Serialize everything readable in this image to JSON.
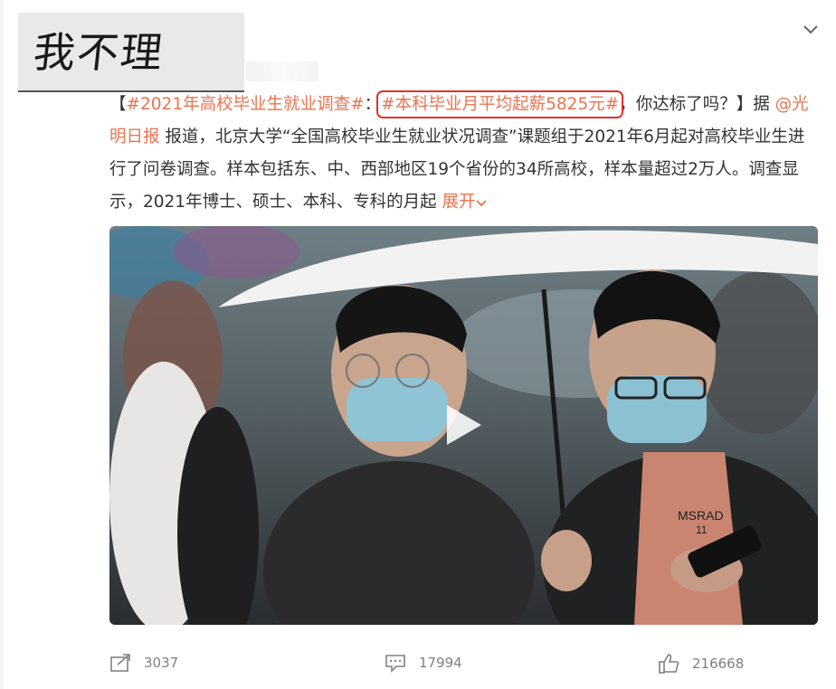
{
  "handwriting": "我不理解。",
  "post": {
    "segments": [
      {
        "kind": "text",
        "text": "【"
      },
      {
        "kind": "topic",
        "text": "#2021年高校毕业生就业调查#"
      },
      {
        "kind": "text",
        "text": "："
      },
      {
        "kind": "topic_boxed",
        "text": "#本科毕业月平均起薪5825元#"
      },
      {
        "kind": "text",
        "text": "，你达标了吗？】据 "
      },
      {
        "kind": "mention",
        "text": "@光明日报"
      },
      {
        "kind": "text",
        "text": " 报道，北京大学“全国高校毕业生就业状况调查”课题组于2021年6月起对高校毕业生进行了问卷调查。样本包括东、中、西部地区19个省份的34所高校，样本量超过2万人。调查显示，2021年博士、硕士、本科、专科的月起 "
      }
    ],
    "expand_label": "展开"
  },
  "media": {
    "icon": "play-icon",
    "shirt_text": "MSRAD",
    "shirt_number": "11"
  },
  "actions": {
    "share_count": "3037",
    "comment_count": "17994",
    "like_count": "216668"
  },
  "colors": {
    "accent": "#eb7350",
    "highlight_box": "#e0322a",
    "meta_text": "#808080"
  }
}
